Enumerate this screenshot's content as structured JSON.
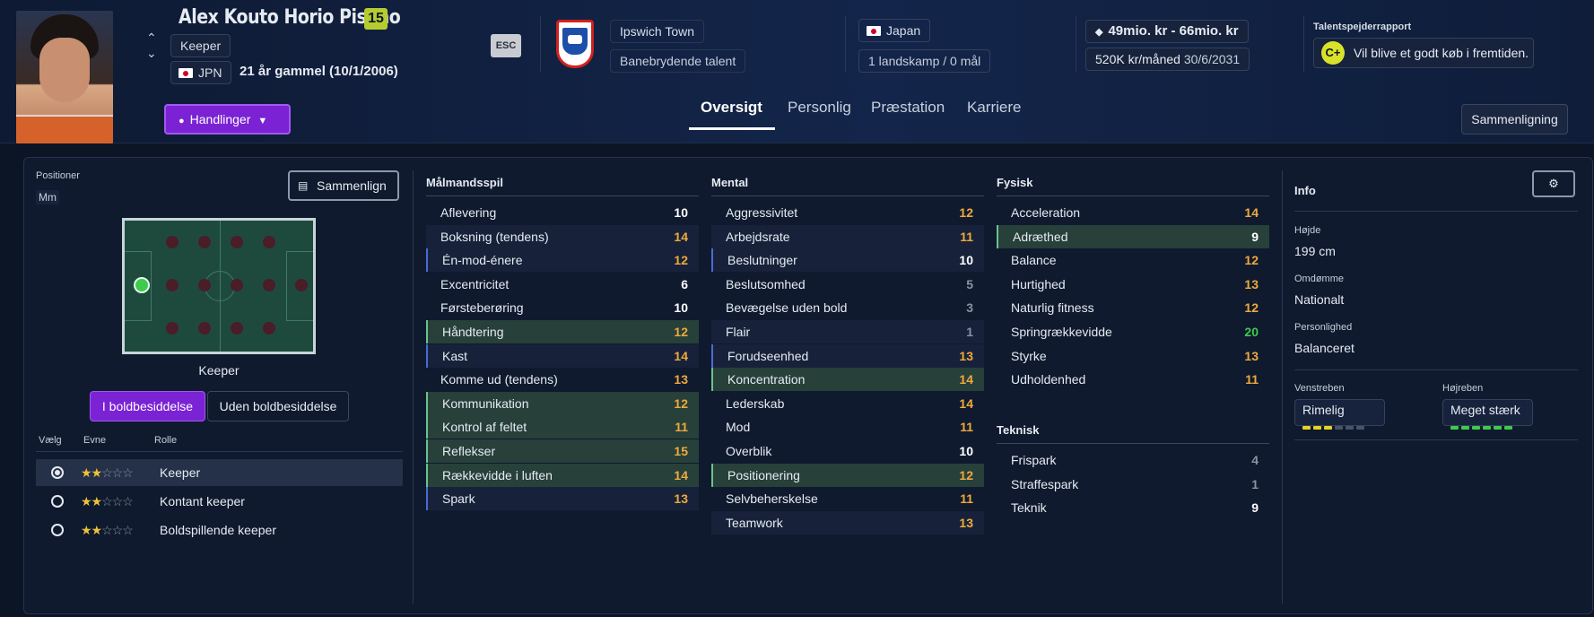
{
  "header": {
    "player_name": "Alex Kouto Horio Pisano",
    "number": "15",
    "position": "Keeper",
    "nation_code": "JPN",
    "age_text": "21 år gammel (10/1/2006)",
    "esc_label": "ESC",
    "club": "Ipswich Town",
    "club_status": "Banebrydende talent",
    "nationality": "Japan",
    "caps": "1 landskamp / 0 mål",
    "value_range": "49mio. kr - 66mio. kr",
    "wage": "520K kr/måned",
    "contract_end": "30/6/2031",
    "scout_report_label": "Talentspejderrapport",
    "scout_grade": "C+",
    "scout_text": "Vil blive et godt køb i fremtiden.",
    "actions_label": "Handlinger",
    "compare_label": "Sammenligning"
  },
  "tabs": [
    "Oversigt",
    "Personlig",
    "Præstation",
    "Karriere"
  ],
  "left": {
    "positions_label": "Positioner",
    "position_short": "Mm",
    "compare_button": "Sammenlign",
    "pitch_label": "Keeper",
    "toggle_in": "I boldbesiddelse",
    "toggle_out": "Uden boldbesiddelse",
    "col_choose": "Vælg",
    "col_ability": "Evne",
    "col_role": "Rolle",
    "roles": [
      {
        "name": "Keeper",
        "stars": 2,
        "selected": true
      },
      {
        "name": "Kontant keeper",
        "stars": 2,
        "selected": false
      },
      {
        "name": "Boldspillende keeper",
        "stars": 2,
        "selected": false
      }
    ]
  },
  "attributes": {
    "goalkeeping": {
      "title": "Målmandsspil",
      "items": [
        {
          "name": "Aflevering",
          "value": "10"
        },
        {
          "name": "Boksning (tendens)",
          "value": "14"
        },
        {
          "name": "Én-mod-énere",
          "value": "12"
        },
        {
          "name": "Excentricitet",
          "value": "6"
        },
        {
          "name": "Førsteberøring",
          "value": "10"
        },
        {
          "name": "Håndtering",
          "value": "12"
        },
        {
          "name": "Kast",
          "value": "14"
        },
        {
          "name": "Komme ud (tendens)",
          "value": "13"
        },
        {
          "name": "Kommunikation",
          "value": "12"
        },
        {
          "name": "Kontrol af feltet",
          "value": "11"
        },
        {
          "name": "Reflekser",
          "value": "15"
        },
        {
          "name": "Rækkevidde i luften",
          "value": "14"
        },
        {
          "name": "Spark",
          "value": "13"
        }
      ]
    },
    "mental": {
      "title": "Mental",
      "items": [
        {
          "name": "Aggressivitet",
          "value": "12"
        },
        {
          "name": "Arbejdsrate",
          "value": "11"
        },
        {
          "name": "Beslutninger",
          "value": "10"
        },
        {
          "name": "Beslutsomhed",
          "value": "5"
        },
        {
          "name": "Bevægelse uden bold",
          "value": "3"
        },
        {
          "name": "Flair",
          "value": "1"
        },
        {
          "name": "Forudseenhed",
          "value": "13"
        },
        {
          "name": "Koncentration",
          "value": "14"
        },
        {
          "name": "Lederskab",
          "value": "14"
        },
        {
          "name": "Mod",
          "value": "11"
        },
        {
          "name": "Overblik",
          "value": "10"
        },
        {
          "name": "Positionering",
          "value": "12"
        },
        {
          "name": "Selvbeherskelse",
          "value": "11"
        },
        {
          "name": "Teamwork",
          "value": "13"
        }
      ]
    },
    "physical": {
      "title": "Fysisk",
      "items": [
        {
          "name": "Acceleration",
          "value": "14"
        },
        {
          "name": "Adræthed",
          "value": "9"
        },
        {
          "name": "Balance",
          "value": "12"
        },
        {
          "name": "Hurtighed",
          "value": "13"
        },
        {
          "name": "Naturlig fitness",
          "value": "12"
        },
        {
          "name": "Springrækkevidde",
          "value": "20"
        },
        {
          "name": "Styrke",
          "value": "13"
        },
        {
          "name": "Udholdenhed",
          "value": "11"
        }
      ]
    },
    "technical": {
      "title": "Teknisk",
      "items": [
        {
          "name": "Frispark",
          "value": "4"
        },
        {
          "name": "Straffespark",
          "value": "1"
        },
        {
          "name": "Teknik",
          "value": "9"
        }
      ]
    }
  },
  "info": {
    "title": "Info",
    "height_label": "Højde",
    "height": "199 cm",
    "reputation_label": "Omdømme",
    "reputation": "Nationalt",
    "personality_label": "Personlighed",
    "personality": "Balanceret",
    "left_foot_label": "Venstreben",
    "left_foot": "Rimelig",
    "left_foot_level": 3,
    "right_foot_label": "Højreben",
    "right_foot": "Meget stærk",
    "right_foot_level": 6
  },
  "colors": {
    "accent": "#7a22d4",
    "yellow": "#f0a93b",
    "green": "#3ccb4c",
    "bg": "#0c1526"
  }
}
